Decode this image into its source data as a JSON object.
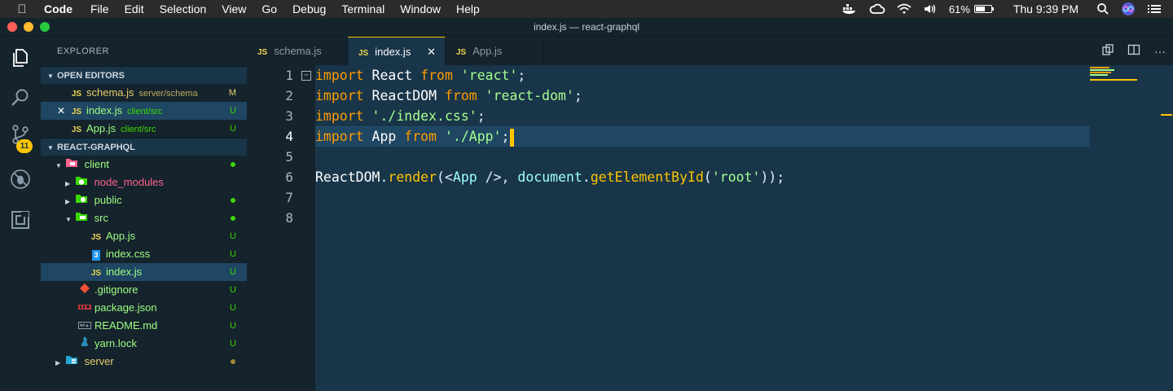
{
  "menubar": {
    "app_name": "Code",
    "items": [
      "File",
      "Edit",
      "Selection",
      "View",
      "Go",
      "Debug",
      "Terminal",
      "Window",
      "Help"
    ],
    "battery_percent": "61%",
    "battery_level": 0.61,
    "clock": "Thu 9:39 PM"
  },
  "window": {
    "title": "index.js — react-graphql",
    "traffic_colors": [
      "#ff5f57",
      "#febc2e",
      "#28c840"
    ]
  },
  "activity": {
    "source_control_badge": "11"
  },
  "sidebar": {
    "title": "EXPLORER",
    "open_editors": {
      "label": "OPEN EDITORS",
      "items": [
        {
          "icon": "JS",
          "name": "schema.js",
          "path": "server/schema",
          "status": "M",
          "close": ""
        },
        {
          "icon": "JS",
          "name": "index.js",
          "path": "client/src",
          "status": "U",
          "close": "✕"
        },
        {
          "icon": "JS",
          "name": "App.js",
          "path": "client/src",
          "status": "U",
          "close": ""
        }
      ]
    },
    "project": {
      "label": "REACT-GRAPHQL",
      "client": "client",
      "node_modules": "node_modules",
      "public": "public",
      "src": "src",
      "src_files": [
        {
          "icon": "JS",
          "name": "App.js",
          "status": "U"
        },
        {
          "icon": "3",
          "name": "index.css",
          "status": "U"
        },
        {
          "icon": "JS",
          "name": "index.js",
          "status": "U"
        }
      ],
      "root_files": [
        {
          "name": ".gitignore",
          "status": "U"
        },
        {
          "name": "package.json",
          "status": "U"
        },
        {
          "name": "README.md",
          "status": "U"
        },
        {
          "name": "yarn.lock",
          "status": "U"
        }
      ],
      "server": "server"
    }
  },
  "tabs": {
    "js_badge": "JS",
    "items": [
      {
        "label": "schema.js"
      },
      {
        "label": "index.js",
        "close": "✕"
      },
      {
        "label": "App.js"
      }
    ]
  },
  "editor": {
    "line_numbers": [
      "1",
      "2",
      "3",
      "4",
      "5",
      "6",
      "7",
      "8"
    ],
    "fold_marker": "−",
    "code": {
      "l1": {
        "kw1": "import",
        "id": " React ",
        "kw2": "from",
        "sp": " ",
        "str": "'react'",
        "end": ";"
      },
      "l2": {
        "kw1": "import",
        "id": " ReactDOM ",
        "kw2": "from",
        "sp": " ",
        "str": "'react-dom'",
        "end": ";"
      },
      "l3": {
        "kw1": "import",
        "sp": " ",
        "str": "'./index.css'",
        "end": ";"
      },
      "l4": {
        "kw1": "import",
        "id": " App ",
        "kw2": "from",
        "sp": " ",
        "str": "'./App'",
        "end": ";"
      },
      "l6": {
        "obj": "ReactDOM",
        "dot1": ".",
        "fn1": "render",
        "p1": "(",
        "lt": "<",
        "cls": "App",
        "tagend": " />",
        "comma": ", ",
        "doc": "document",
        "dot2": ".",
        "fn2": "getElementById",
        "p2": "(",
        "str": "'root'",
        "p3": "));"
      }
    }
  },
  "colors": {
    "background": "#193549",
    "sidebar": "#15232d",
    "accent": "#ffc600",
    "keyword": "#ff9d00",
    "string": "#a5ff90"
  }
}
